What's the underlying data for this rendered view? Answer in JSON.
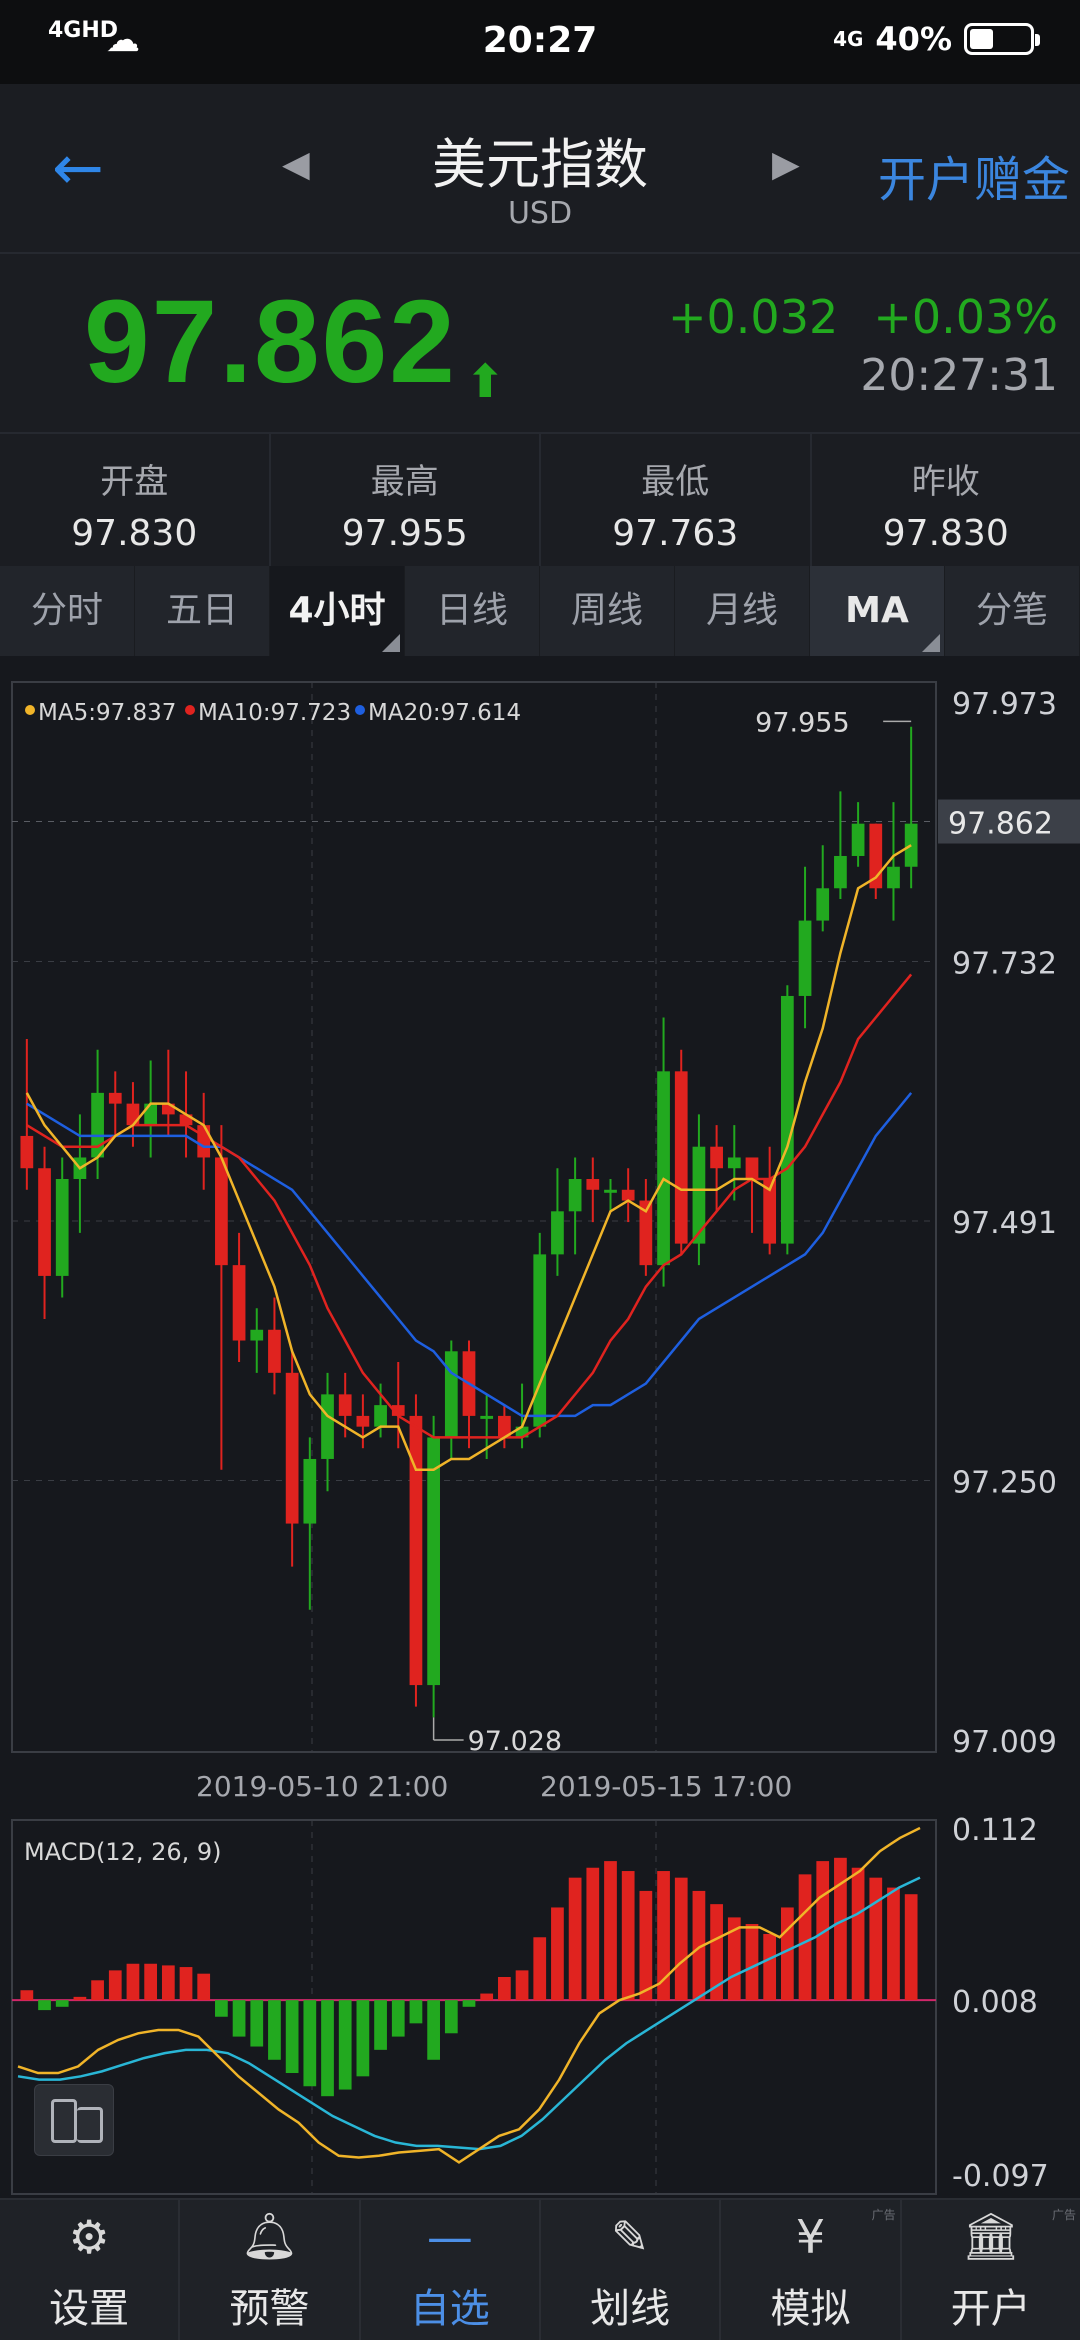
{
  "status_bar": {
    "network": "4GHD",
    "time": "20:27",
    "network_right": "4G",
    "battery": "40%",
    "battery_level": 0.4
  },
  "header": {
    "title": "美元指数",
    "subtitle": "USD",
    "open_account": "开户赠金"
  },
  "quote": {
    "price": "97.862",
    "change": "+0.032",
    "change_pct": "+0.03%",
    "time": "20:27:31"
  },
  "stats": [
    {
      "label": "开盘",
      "value": "97.830"
    },
    {
      "label": "最高",
      "value": "97.955"
    },
    {
      "label": "最低",
      "value": "97.763"
    },
    {
      "label": "昨收",
      "value": "97.830"
    }
  ],
  "tabs": [
    "分时",
    "五日",
    "4小时",
    "日线",
    "周线",
    "月线",
    "MA",
    "分笔"
  ],
  "active_tab": "4小时",
  "chart_data": {
    "type": "candlestick",
    "legend": [
      {
        "name": "MA5",
        "value": "97.837",
        "color": "#f0b429"
      },
      {
        "name": "MA10",
        "value": "97.723",
        "color": "#e0231f"
      },
      {
        "name": "MA20",
        "value": "97.614",
        "color": "#1e5fe0"
      }
    ],
    "legend_text": [
      "MA5:97.837",
      "MA10:97.723",
      "MA20:97.614"
    ],
    "y_ticks": [
      "97.973",
      "97.732",
      "97.491",
      "97.250",
      "97.009"
    ],
    "current_price_label": "97.862",
    "max_label": "97.955",
    "min_label": "97.028",
    "x_labels": [
      "2019-05-10 21:00",
      "2019-05-15 17:00"
    ],
    "ylim": [
      97.009,
      97.973
    ],
    "candles": [
      [
        97.57,
        97.54,
        97.66,
        97.52
      ],
      [
        97.54,
        97.44,
        97.56,
        97.4
      ],
      [
        97.44,
        97.53,
        97.55,
        97.42
      ],
      [
        97.53,
        97.55,
        97.59,
        97.48
      ],
      [
        97.55,
        97.61,
        97.65,
        97.53
      ],
      [
        97.61,
        97.6,
        97.63,
        97.57
      ],
      [
        97.6,
        97.58,
        97.62,
        97.56
      ],
      [
        97.58,
        97.6,
        97.64,
        97.55
      ],
      [
        97.6,
        97.59,
        97.65,
        97.57
      ],
      [
        97.59,
        97.58,
        97.63,
        97.55
      ],
      [
        97.58,
        97.55,
        97.61,
        97.52
      ],
      [
        97.55,
        97.45,
        97.58,
        97.26
      ],
      [
        97.45,
        97.38,
        97.48,
        97.36
      ],
      [
        97.38,
        97.39,
        97.41,
        97.35
      ],
      [
        97.39,
        97.35,
        97.42,
        97.33
      ],
      [
        97.35,
        97.21,
        97.37,
        97.17
      ],
      [
        97.21,
        97.27,
        97.29,
        97.13
      ],
      [
        97.27,
        97.33,
        97.35,
        97.24
      ],
      [
        97.33,
        97.31,
        97.35,
        97.29
      ],
      [
        97.31,
        97.3,
        97.33,
        97.28
      ],
      [
        97.3,
        97.32,
        97.34,
        97.29
      ],
      [
        97.32,
        97.31,
        97.36,
        97.28
      ],
      [
        97.31,
        97.06,
        97.33,
        97.04
      ],
      [
        97.06,
        97.29,
        97.31,
        97.03
      ],
      [
        97.29,
        97.37,
        97.38,
        97.27
      ],
      [
        97.37,
        97.31,
        97.38,
        97.28
      ],
      [
        97.31,
        97.31,
        97.33,
        97.27
      ],
      [
        97.31,
        97.29,
        97.32,
        97.28
      ],
      [
        97.29,
        97.3,
        97.34,
        97.28
      ],
      [
        97.3,
        97.46,
        97.48,
        97.29
      ],
      [
        97.46,
        97.5,
        97.54,
        97.44
      ],
      [
        97.5,
        97.53,
        97.55,
        97.46
      ],
      [
        97.53,
        97.52,
        97.55,
        97.49
      ],
      [
        97.52,
        97.52,
        97.53,
        97.5
      ],
      [
        97.52,
        97.51,
        97.54,
        97.49
      ],
      [
        97.51,
        97.45,
        97.53,
        97.44
      ],
      [
        97.45,
        97.63,
        97.68,
        97.43
      ],
      [
        97.63,
        97.47,
        97.65,
        97.46
      ],
      [
        97.47,
        97.56,
        97.59,
        97.45
      ],
      [
        97.56,
        97.54,
        97.58,
        97.5
      ],
      [
        97.54,
        97.55,
        97.58,
        97.51
      ],
      [
        97.55,
        97.53,
        97.55,
        97.48
      ],
      [
        97.53,
        97.47,
        97.56,
        97.46
      ],
      [
        97.47,
        97.7,
        97.71,
        97.46
      ],
      [
        97.7,
        97.77,
        97.82,
        97.67
      ],
      [
        97.77,
        97.8,
        97.84,
        97.76
      ],
      [
        97.8,
        97.83,
        97.89,
        97.79
      ],
      [
        97.83,
        97.86,
        97.88,
        97.82
      ],
      [
        97.86,
        97.8,
        97.86,
        97.79
      ],
      [
        97.8,
        97.82,
        97.88,
        97.77
      ],
      [
        97.82,
        97.86,
        97.95,
        97.8
      ]
    ],
    "ma5": [
      97.61,
      97.58,
      97.56,
      97.54,
      97.55,
      97.57,
      97.58,
      97.6,
      97.6,
      97.59,
      97.58,
      97.55,
      97.51,
      97.47,
      97.43,
      97.37,
      97.33,
      97.31,
      97.3,
      97.29,
      97.3,
      97.3,
      97.26,
      97.26,
      97.27,
      97.27,
      97.28,
      97.29,
      97.3,
      97.34,
      97.38,
      97.42,
      97.46,
      97.5,
      97.51,
      97.5,
      97.53,
      97.52,
      97.52,
      97.52,
      97.53,
      97.53,
      97.52,
      97.56,
      97.62,
      97.67,
      97.74,
      97.8,
      97.81,
      97.83,
      97.84
    ],
    "ma10": [
      97.58,
      97.57,
      97.56,
      97.56,
      97.56,
      97.57,
      97.58,
      97.58,
      97.58,
      97.58,
      97.57,
      97.56,
      97.55,
      97.53,
      97.51,
      97.48,
      97.45,
      97.41,
      97.38,
      97.35,
      97.33,
      97.31,
      97.3,
      97.29,
      97.29,
      97.29,
      97.29,
      97.29,
      97.29,
      97.3,
      97.31,
      97.33,
      97.35,
      97.38,
      97.4,
      97.43,
      97.45,
      97.46,
      97.48,
      97.5,
      97.52,
      97.53,
      97.53,
      97.54,
      97.56,
      97.59,
      97.62,
      97.66,
      97.68,
      97.7,
      97.72
    ],
    "ma20": [
      97.6,
      97.59,
      97.58,
      97.57,
      97.57,
      97.57,
      97.57,
      97.57,
      97.57,
      97.57,
      97.56,
      97.56,
      97.55,
      97.54,
      97.53,
      97.52,
      97.5,
      97.48,
      97.46,
      97.44,
      97.42,
      97.4,
      97.38,
      97.37,
      97.35,
      97.34,
      97.33,
      97.32,
      97.31,
      97.31,
      97.31,
      97.31,
      97.32,
      97.32,
      97.33,
      97.34,
      97.36,
      97.38,
      97.4,
      97.41,
      97.42,
      97.43,
      97.44,
      97.45,
      97.46,
      97.48,
      97.51,
      97.54,
      97.57,
      97.59,
      97.61
    ]
  },
  "macd": {
    "label": "MACD(12, 26, 9)",
    "y_ticks": [
      "0.112",
      "0.008",
      "-0.097"
    ],
    "ylim": [
      -0.097,
      0.112
    ],
    "hist": [
      0.006,
      -0.006,
      -0.004,
      0.002,
      0.012,
      0.018,
      0.022,
      0.022,
      0.021,
      0.02,
      0.016,
      -0.01,
      -0.022,
      -0.028,
      -0.036,
      -0.044,
      -0.052,
      -0.058,
      -0.054,
      -0.046,
      -0.03,
      -0.022,
      -0.014,
      -0.036,
      -0.02,
      -0.004,
      0.004,
      0.014,
      0.018,
      0.038,
      0.056,
      0.074,
      0.08,
      0.084,
      0.078,
      0.066,
      0.078,
      0.074,
      0.066,
      0.058,
      0.05,
      0.046,
      0.04,
      0.056,
      0.076,
      0.084,
      0.086,
      0.08,
      0.074,
      0.068,
      0.064
    ],
    "dif": [
      -0.032,
      -0.036,
      -0.036,
      -0.032,
      -0.022,
      -0.016,
      -0.012,
      -0.01,
      -0.01,
      -0.014,
      -0.026,
      -0.038,
      -0.048,
      -0.058,
      -0.066,
      -0.078,
      -0.086,
      -0.087,
      -0.086,
      -0.084,
      -0.083,
      -0.082,
      -0.09,
      -0.082,
      -0.074,
      -0.07,
      -0.058,
      -0.04,
      -0.018,
      0.0,
      0.008,
      0.012,
      0.018,
      0.03,
      0.04,
      0.046,
      0.052,
      0.052,
      0.046,
      0.058,
      0.07,
      0.078,
      0.086,
      0.098,
      0.106,
      0.112
    ],
    "dea": [
      -0.038,
      -0.04,
      -0.04,
      -0.038,
      -0.035,
      -0.031,
      -0.027,
      -0.024,
      -0.022,
      -0.022,
      -0.024,
      -0.03,
      -0.038,
      -0.046,
      -0.054,
      -0.062,
      -0.068,
      -0.074,
      -0.078,
      -0.08,
      -0.08,
      -0.081,
      -0.082,
      -0.08,
      -0.074,
      -0.064,
      -0.052,
      -0.04,
      -0.028,
      -0.018,
      -0.01,
      -0.002,
      0.006,
      0.014,
      0.022,
      0.028,
      0.034,
      0.04,
      0.046,
      0.054,
      0.06,
      0.068,
      0.076,
      0.082
    ]
  },
  "nav": [
    {
      "label": "设置",
      "icon": "gear-icon"
    },
    {
      "label": "预警",
      "icon": "bell-icon"
    },
    {
      "label": "自选",
      "icon": "minus-icon"
    },
    {
      "label": "划线",
      "icon": "pen-icon"
    },
    {
      "label": "模拟",
      "icon": "yen-icon"
    },
    {
      "label": "开户",
      "icon": "bank-icon"
    }
  ],
  "ad_tag": "广告",
  "colors": {
    "up": "#22a91f",
    "down": "#e0231f",
    "accent": "#3b86df"
  }
}
